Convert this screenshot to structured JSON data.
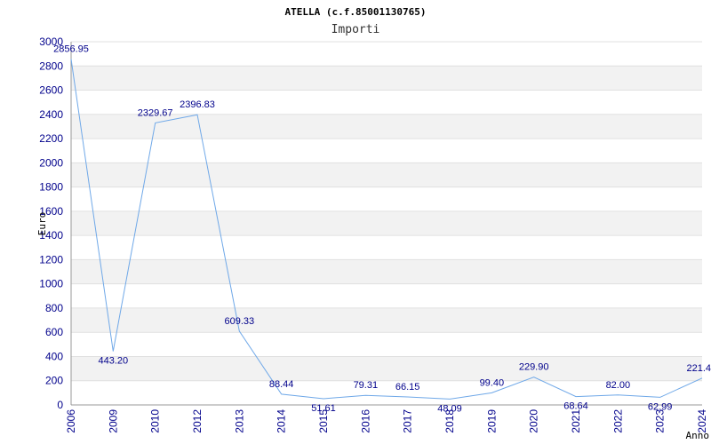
{
  "title": "ATELLA (c.f.85001130765)",
  "subtitle": "Importi",
  "chart_data": {
    "type": "line",
    "title": "ATELLA (c.f.85001130765)",
    "subtitle": "Importi",
    "xlabel": "Anno",
    "ylabel": "Euro",
    "ylim": [
      0,
      3000
    ],
    "yticks": [
      0,
      200,
      400,
      600,
      800,
      1000,
      1200,
      1400,
      1600,
      1800,
      2000,
      2200,
      2400,
      2600,
      2800,
      3000
    ],
    "grid": true,
    "legend": "none",
    "categories": [
      "2006",
      "2009",
      "2010",
      "2012",
      "2013",
      "2014",
      "2015",
      "2016",
      "2017",
      "2018",
      "2019",
      "2020",
      "2021",
      "2022",
      "2023",
      "2024"
    ],
    "series": [
      {
        "values": [
          2856.95,
          443.2,
          2329.67,
          2396.83,
          609.33,
          88.44,
          51.61,
          79.31,
          66.15,
          48.09,
          99.4,
          229.9,
          68.64,
          82.0,
          62.99,
          221.4
        ],
        "labels": [
          "2856.95",
          "443.20",
          "2329.67",
          "2396.83",
          "609.33",
          "88.44",
          "51.61",
          "79.31",
          "66.15",
          "48.09",
          "99.40",
          "229.90",
          "68.64",
          "82.00",
          "62.99",
          "221.4"
        ]
      }
    ],
    "colors": {
      "line": "#6fa8e8",
      "band": "#f2f2f2",
      "tick": "#00008b",
      "grid": "#e0e0e0"
    }
  }
}
